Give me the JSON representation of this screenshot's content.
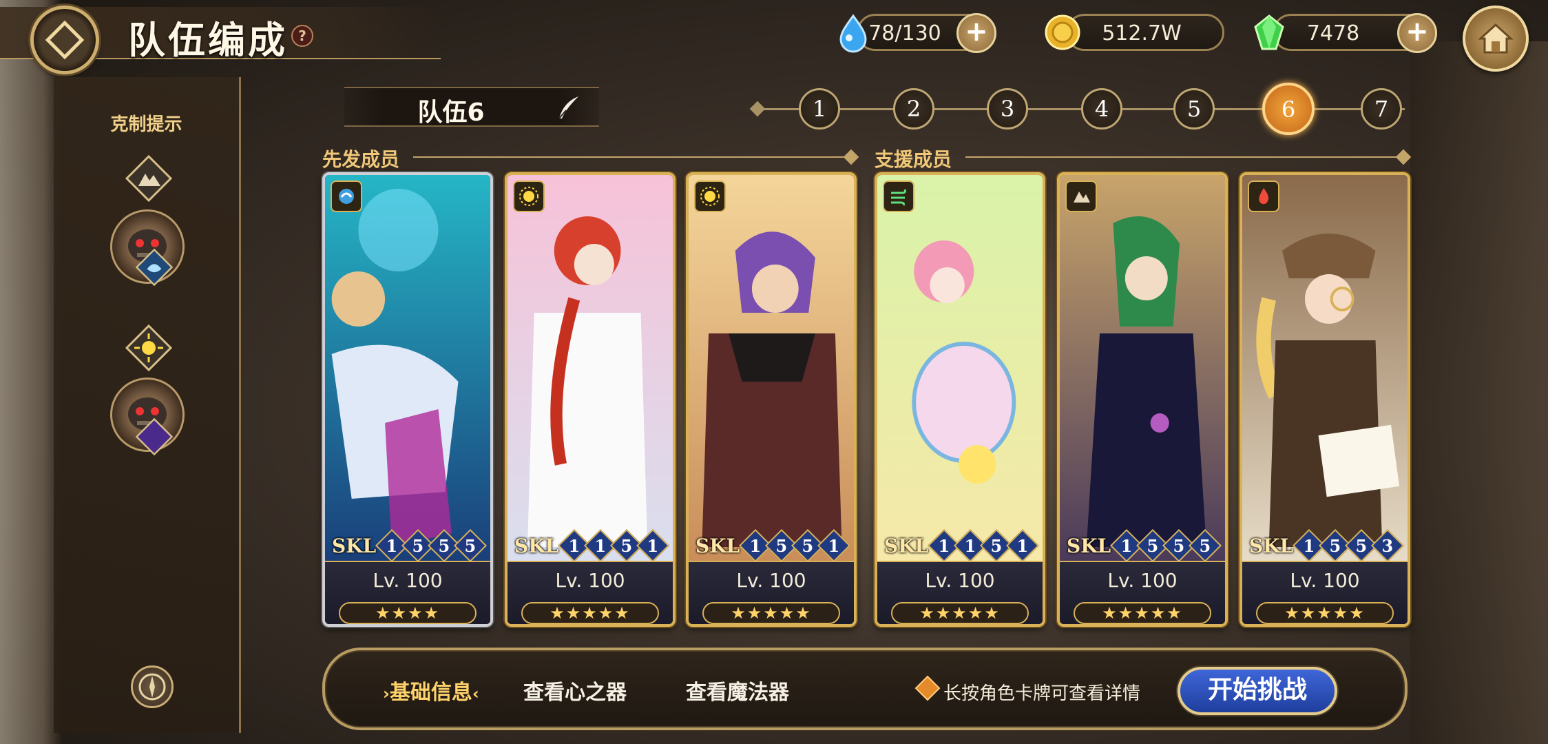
{
  "header": {
    "title": "队伍编成",
    "help_icon": "question-icon",
    "resources": [
      {
        "icon": "water-drop-icon",
        "value": "78/130",
        "has_plus": true
      },
      {
        "icon": "gold-coin-icon",
        "value": "512.7W",
        "has_plus": false
      },
      {
        "icon": "green-gem-icon",
        "value": "7478",
        "has_plus": true
      }
    ]
  },
  "left_panel": {
    "hint_label": "克制提示"
  },
  "team": {
    "name": "队伍6",
    "slots": [
      "1",
      "2",
      "3",
      "4",
      "5",
      "6",
      "7"
    ],
    "active_slot": "6"
  },
  "sections": {
    "front": "先发成员",
    "support": "支援成员"
  },
  "cards": [
    {
      "element": "water",
      "skl_label": "SKL",
      "skills": [
        "1",
        "5",
        "5",
        "5"
      ],
      "level": "Lv. 100",
      "stars": "★★★★",
      "frame": "silver"
    },
    {
      "element": "light",
      "skl_label": "SKL",
      "skills": [
        "1",
        "1",
        "5",
        "1"
      ],
      "level": "Lv. 100",
      "stars": "★★★★★",
      "frame": "gold"
    },
    {
      "element": "light",
      "skl_label": "SKL",
      "skills": [
        "1",
        "5",
        "5",
        "1"
      ],
      "level": "Lv. 100",
      "stars": "★★★★★",
      "frame": "gold"
    },
    {
      "element": "wind",
      "skl_label": "SKL",
      "skills": [
        "1",
        "1",
        "5",
        "1"
      ],
      "level": "Lv. 100",
      "stars": "★★★★★",
      "frame": "gold"
    },
    {
      "element": "earth",
      "skl_label": "SKL",
      "skills": [
        "1",
        "5",
        "5",
        "5"
      ],
      "level": "Lv. 100",
      "stars": "★★★★★",
      "frame": "gold"
    },
    {
      "element": "fire",
      "skl_label": "SKL",
      "skills": [
        "1",
        "5",
        "5",
        "3"
      ],
      "level": "Lv. 100",
      "stars": "★★★★★",
      "frame": "gold"
    }
  ],
  "bottom": {
    "tabs": [
      "基础信息",
      "查看心之器",
      "查看魔法器"
    ],
    "tip": "长按角色卡牌可查看详情",
    "start_button": "开始挑战"
  },
  "colors": {
    "accent_gold": "#d9b257",
    "active_slot": "#f2a43a",
    "start_button": "#2f56c8"
  }
}
